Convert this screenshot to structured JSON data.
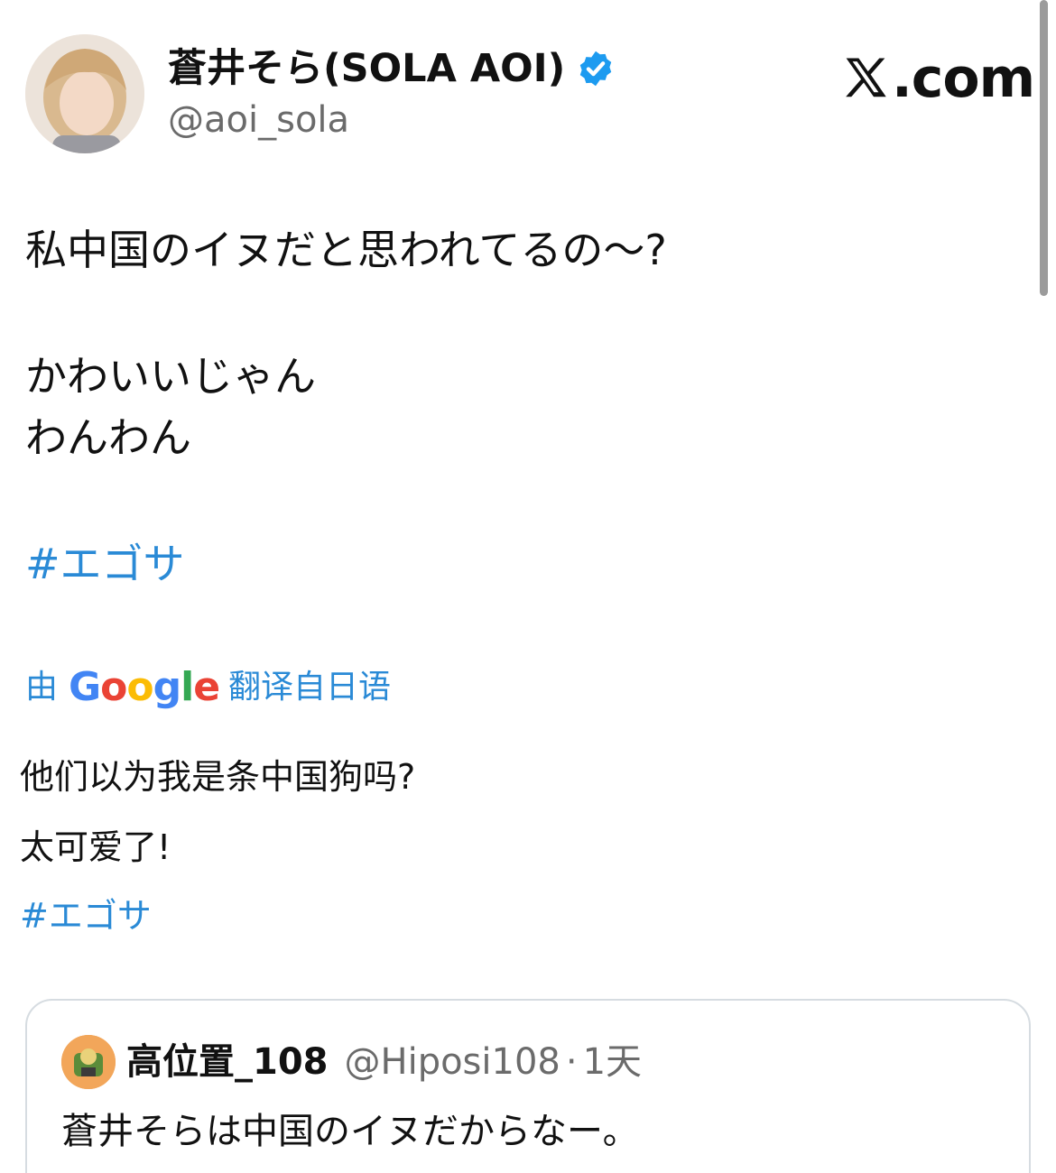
{
  "author": {
    "display_name": "蒼井そら(SOLA AOI)",
    "handle": "@aoi_sola",
    "verified_icon": "verified-badge-icon"
  },
  "brand": {
    "site": ".com",
    "logo_icon": "x-logo-icon"
  },
  "tweet": {
    "lines": [
      "私中国のイヌだと思われてるの～?",
      "かわいいじゃん",
      "わんわん"
    ],
    "hashtag": "#エゴサ"
  },
  "translation": {
    "prefix": "由",
    "provider": "Google",
    "suffix": "翻译自日语",
    "lines": [
      "他们以为我是条中国狗吗?",
      "太可爱了!"
    ],
    "hashtag": "#エゴサ"
  },
  "quoted_tweet": {
    "display_name": "高位置_108",
    "handle": "@Hiposi108",
    "separator": "·",
    "time": "1天",
    "text": "蒼井そらは中国のイヌだからなー。"
  },
  "colors": {
    "link": "#2a8ad6",
    "verified": "#1d9bf0",
    "secondary_text": "#6b6b6b",
    "card_border": "#d6dce1"
  }
}
